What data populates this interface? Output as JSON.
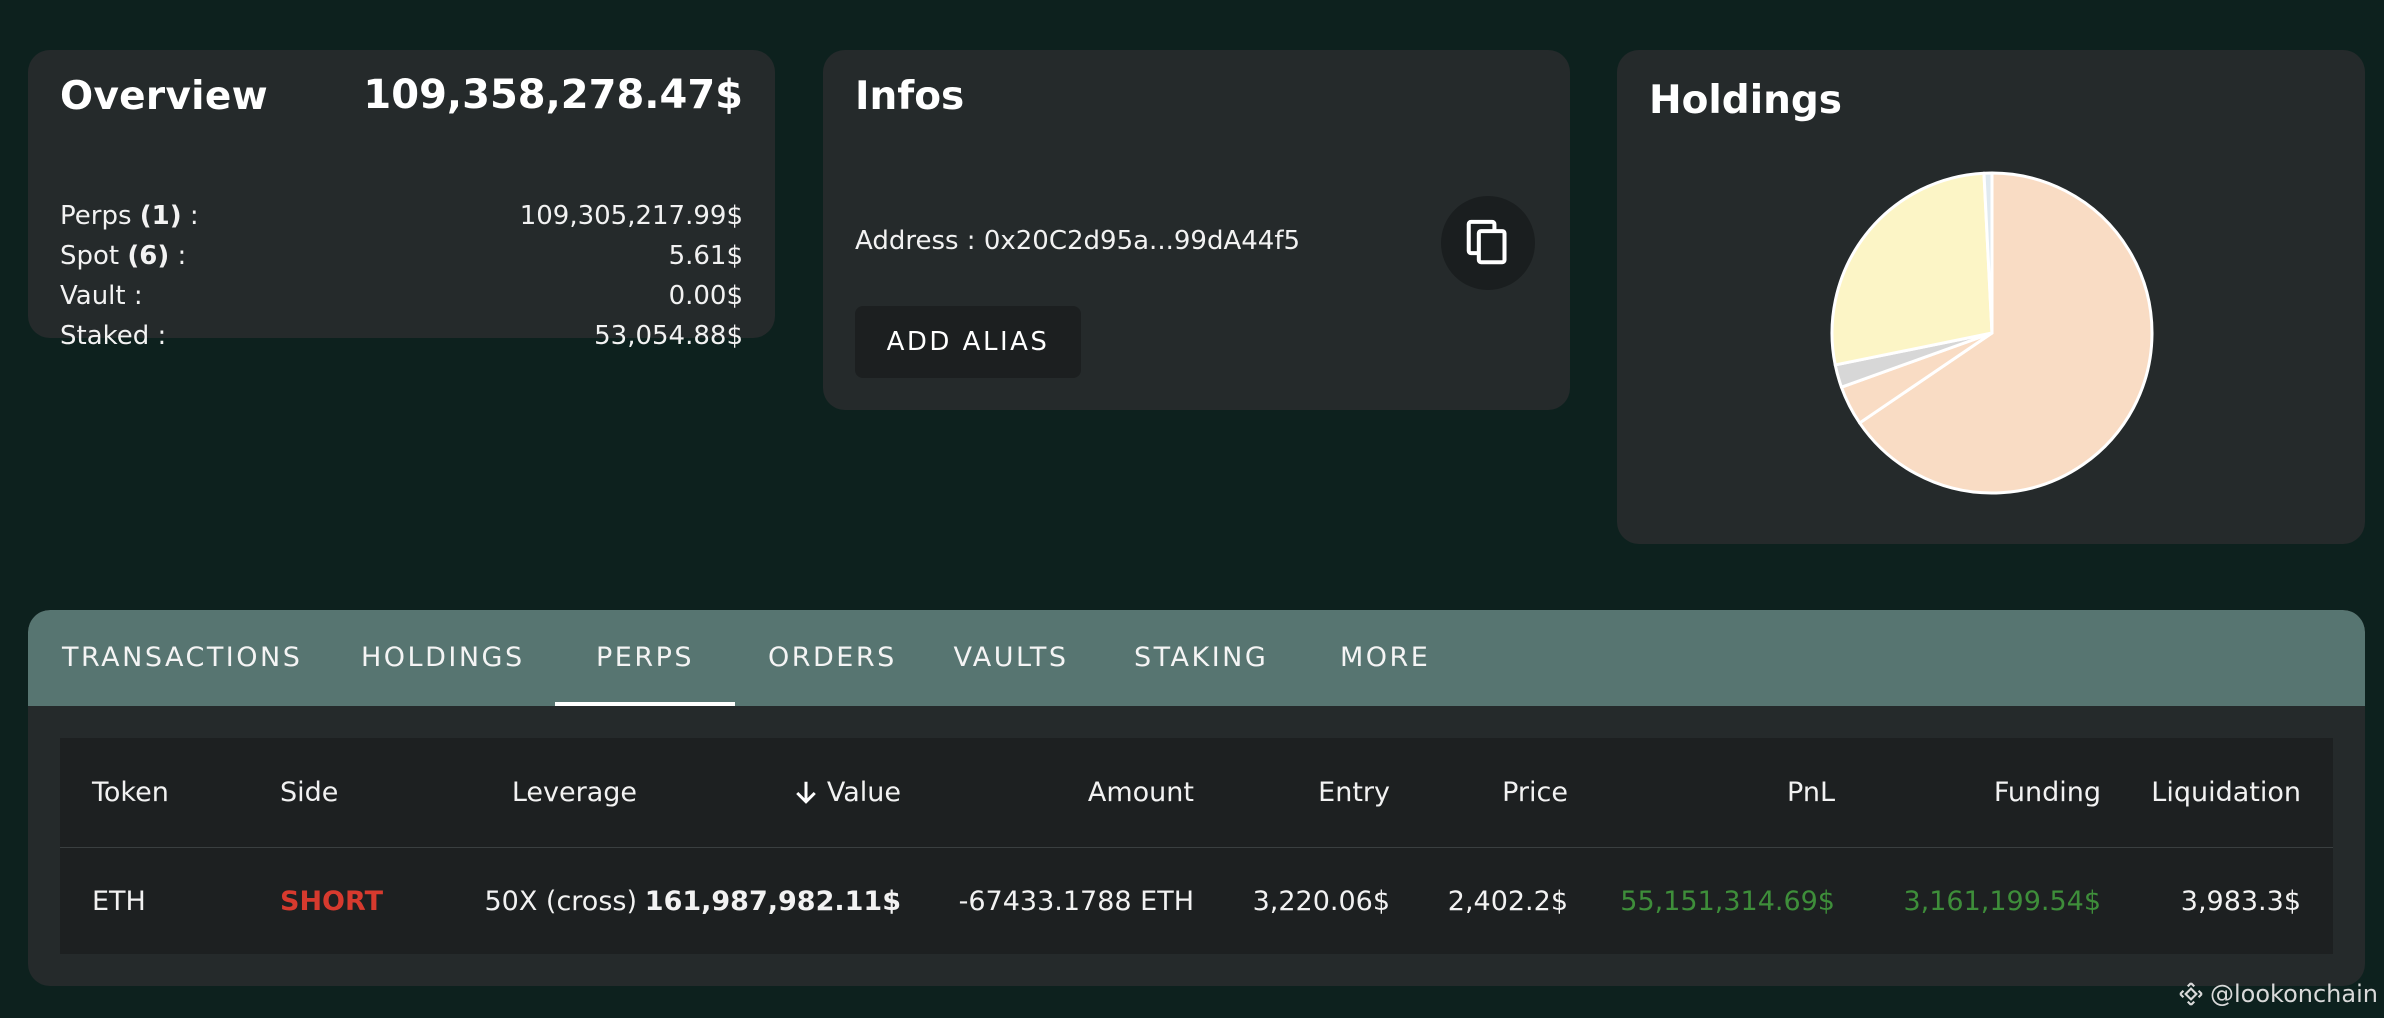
{
  "overview": {
    "title": "Overview",
    "total": "109,358,278.47$",
    "rows": [
      {
        "label": "Perps ",
        "count": "(1)",
        "suffix": " :",
        "value": "109,305,217.99$"
      },
      {
        "label": "Spot ",
        "count": "(6)",
        "suffix": " :",
        "value": "5.61$"
      },
      {
        "label": "Vault :",
        "count": "",
        "suffix": "",
        "value": "0.00$"
      },
      {
        "label": "Staked :",
        "count": "",
        "suffix": "",
        "value": "53,054.88$"
      }
    ]
  },
  "infos": {
    "title": "Infos",
    "address": "Address : 0x20C2d95a...99dA44f5",
    "add_alias": "ADD ALIAS",
    "copy_icon": "copy-icon"
  },
  "holdings": {
    "title": "Holdings",
    "chart_data": {
      "type": "pie",
      "slices": [
        {
          "value": 65.5,
          "color": "#f9dcc4"
        },
        {
          "value": 4.0,
          "color": "#f9dcc4"
        },
        {
          "value": 2.3,
          "color": "#d7d7d7"
        },
        {
          "value": 27.4,
          "color": "#fcf5c6"
        },
        {
          "value": 0.8,
          "color": "#dfe9ef"
        }
      ]
    }
  },
  "tabs": [
    {
      "label": "TRANSACTIONS",
      "active": false
    },
    {
      "label": "HOLDINGS",
      "active": false
    },
    {
      "label": "PERPS",
      "active": true
    },
    {
      "label": "ORDERS",
      "active": false
    },
    {
      "label": "VAULTS",
      "active": false
    },
    {
      "label": "STAKING",
      "active": false
    },
    {
      "label": "MORE",
      "active": false
    }
  ],
  "table": {
    "headers": [
      "Token",
      "Side",
      "Leverage",
      "Value",
      "Amount",
      "Entry",
      "Price",
      "PnL",
      "Funding",
      "Liquidation"
    ],
    "rows": [
      [
        "ETH",
        "SHORT",
        "50X (cross)",
        "161,987,982.11$",
        "-67433.1788 ETH",
        "3,220.06$",
        "2,402.2$",
        "55,151,314.69$",
        "3,161,199.54$",
        "3,983.3$"
      ]
    ]
  },
  "colors": {
    "background": "#0d211e",
    "card": "#252a2b",
    "tabbar": "#577571",
    "short": "#d73a2e",
    "positive": "#3e8e3a"
  },
  "watermark": "@lookonchain"
}
